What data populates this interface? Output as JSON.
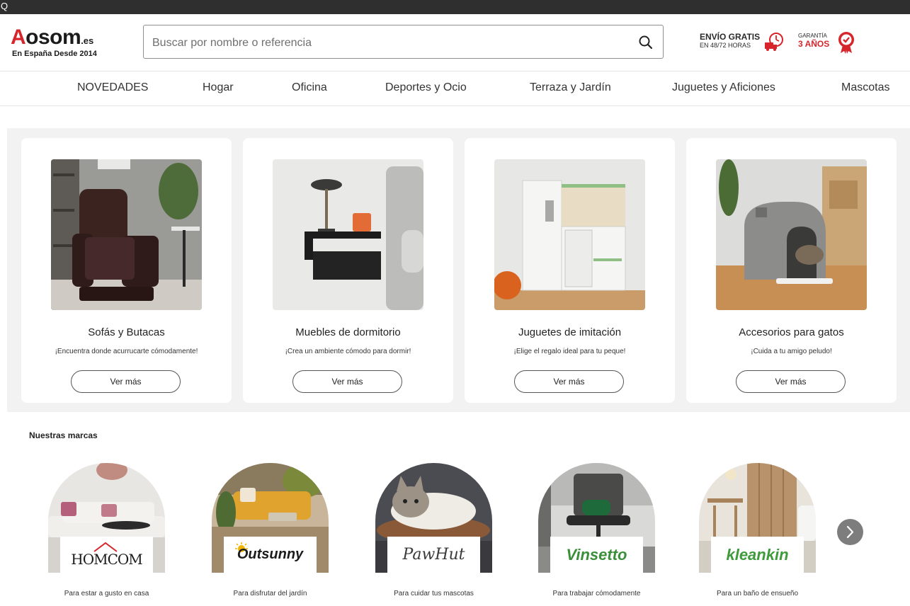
{
  "topbar": {
    "glyph": "Q"
  },
  "header": {
    "logo": {
      "brand_initial": "A",
      "brand_rest": "osom",
      "brand_suffix": ".es",
      "tagline": "En España Desde 2014"
    },
    "search": {
      "placeholder": "Buscar por nombre o referencia",
      "icon": "search-icon"
    },
    "shipping": {
      "line1": "ENVÍO GRATIS",
      "line2": "EN 48/72 HORAS",
      "icons": [
        "truck-icon",
        "clock-icon"
      ]
    },
    "warranty": {
      "line1": "GARANTÍA",
      "line2": "3 AÑOS",
      "icon": "badge-check-icon"
    }
  },
  "nav": {
    "items": [
      "NOVEDADES",
      "Hogar",
      "Oficina",
      "Deportes y Ocio",
      "Terraza y Jardín",
      "Juguetes y Aficiones",
      "Mascotas"
    ]
  },
  "categories": [
    {
      "title": "Sofás y Butacas",
      "subtitle": "¡Encuentra donde acurrucarte cómodamente!",
      "button": "Ver más"
    },
    {
      "title": "Muebles de dormitorio",
      "subtitle": "¡Crea un ambiente cómodo para dormir!",
      "button": "Ver más"
    },
    {
      "title": "Juguetes de imitación",
      "subtitle": "¡Elige el regalo ideal para tu peque!",
      "button": "Ver más"
    },
    {
      "title": "Accesorios para gatos",
      "subtitle": "¡Cuida a tu amigo peludo!",
      "button": "Ver más"
    }
  ],
  "brands": {
    "title": "Nuestras marcas",
    "items": [
      {
        "name": "HOMCOM",
        "caption": "Para estar a gusto en casa"
      },
      {
        "name": "Outsunny",
        "caption": "Para disfrutar del jardín"
      },
      {
        "name": "PawHut",
        "caption": "Para cuidar tus mascotas"
      },
      {
        "name": "Vinsetto",
        "caption": "Para trabajar cómodamente"
      },
      {
        "name": "kleankin",
        "caption": "Para un baño de ensueño"
      }
    ],
    "next_icon": "chevron-right-icon"
  },
  "colors": {
    "brand_red": "#d7252c",
    "topbar": "#2f2f2f",
    "panel_bg": "#f2f2f2"
  }
}
